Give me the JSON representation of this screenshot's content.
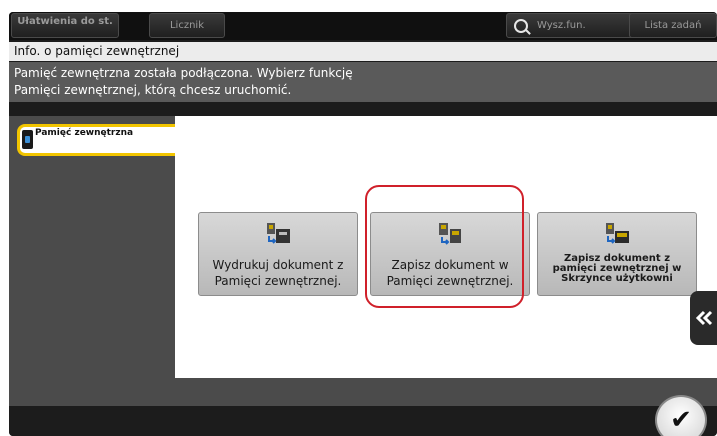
{
  "topbar": {
    "accessibility_label": "Ułatwienia do st.",
    "counter_label": "Licznik",
    "search_label": "Wysz.fun.",
    "job_list_label": "Lista zadań"
  },
  "title": "Info. o pamięci zewnętrznej",
  "message": {
    "line1": "Pamięć zewnętrzna została podłączona. Wybierz funkcję",
    "line2": "Pamięci zewnętrznej, którą chcesz uruchomić."
  },
  "sidebar": {
    "tab_label": "Pamięć zewnętrzna"
  },
  "functions": [
    {
      "label": "Wydrukuj dokument z Pamięci zewnętrznej.",
      "icon": "print-from-usb-icon"
    },
    {
      "label": "Zapisz dokument w Pamięci zewnętrznej.",
      "icon": "save-to-usb-icon"
    },
    {
      "label": "Zapisz dokument z pamięci zewnętrznej w Skrzynce użytkowni",
      "icon": "save-to-user-box-icon"
    }
  ],
  "colors": {
    "accent_tab": "#f2c500",
    "highlight": "#d0202a"
  },
  "ok_button": {
    "symbol": "✔"
  }
}
